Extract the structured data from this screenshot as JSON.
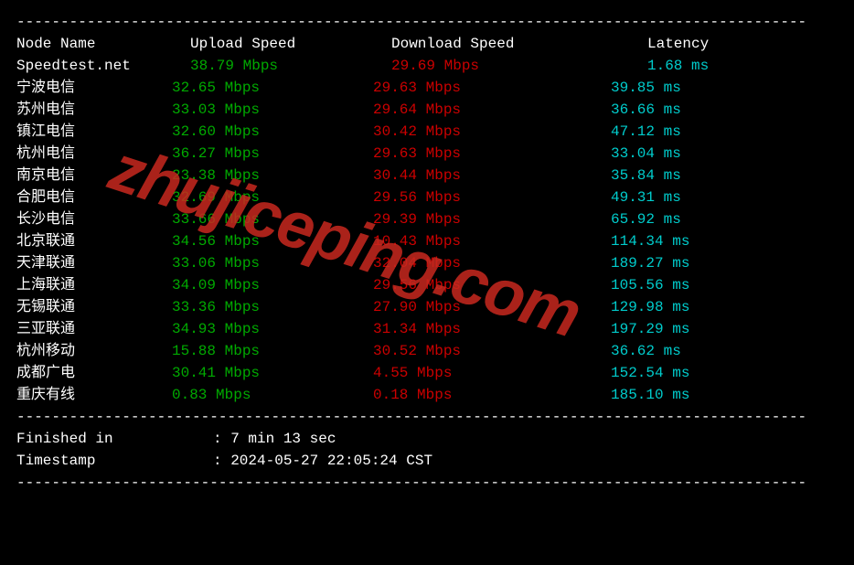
{
  "headers": {
    "node": "Node Name",
    "upload": "Upload Speed",
    "download": "Download Speed",
    "latency": "Latency"
  },
  "speedtest_row": {
    "name": "Speedtest.net",
    "upload": "38.79 Mbps",
    "download": "29.69 Mbps",
    "latency": "1.68 ms"
  },
  "rows": [
    {
      "name": "宁波电信",
      "upload": "32.65 Mbps",
      "download": "29.63 Mbps",
      "latency": "39.85 ms"
    },
    {
      "name": "苏州电信",
      "upload": "33.03 Mbps",
      "download": "29.64 Mbps",
      "latency": "36.66 ms"
    },
    {
      "name": "镇江电信",
      "upload": "32.60 Mbps",
      "download": "30.42 Mbps",
      "latency": "47.12 ms"
    },
    {
      "name": "杭州电信",
      "upload": "36.27 Mbps",
      "download": "29.63 Mbps",
      "latency": "33.04 ms"
    },
    {
      "name": "南京电信",
      "upload": "23.38 Mbps",
      "download": "30.44 Mbps",
      "latency": "35.84 ms"
    },
    {
      "name": "合肥电信",
      "upload": "32.69 Mbps",
      "download": "29.56 Mbps",
      "latency": "49.31 ms"
    },
    {
      "name": "长沙电信",
      "upload": "33.66 Mbps",
      "download": "29.39 Mbps",
      "latency": "65.92 ms"
    },
    {
      "name": "北京联通",
      "upload": "34.56 Mbps",
      "download": "10.43 Mbps",
      "latency": "114.34 ms"
    },
    {
      "name": "天津联通",
      "upload": "33.06 Mbps",
      "download": "32.04 Mbps",
      "latency": "189.27 ms"
    },
    {
      "name": "上海联通",
      "upload": "34.09 Mbps",
      "download": "29.56 Mbps",
      "latency": "105.56 ms"
    },
    {
      "name": "无锡联通",
      "upload": "33.36 Mbps",
      "download": "27.90 Mbps",
      "latency": "129.98 ms"
    },
    {
      "name": "三亚联通",
      "upload": "34.93 Mbps",
      "download": "31.34 Mbps",
      "latency": "197.29 ms"
    },
    {
      "name": "杭州移动",
      "upload": "15.88 Mbps",
      "download": "30.52 Mbps",
      "latency": "36.62 ms"
    },
    {
      "name": "成都广电",
      "upload": "30.41 Mbps",
      "download": "4.55 Mbps",
      "latency": "152.54 ms"
    },
    {
      "name": "重庆有线",
      "upload": "0.83 Mbps",
      "download": "0.18 Mbps",
      "latency": "185.10 ms"
    }
  ],
  "footer": {
    "finished_label": "Finished in",
    "finished_value": ": 7 min 13 sec",
    "timestamp_label": "Timestamp",
    "timestamp_value": ": 2024-05-27 22:05:24 CST"
  },
  "dashes": "------------------------------------------------------------------------------------------",
  "watermark": "zhujiceping.com"
}
